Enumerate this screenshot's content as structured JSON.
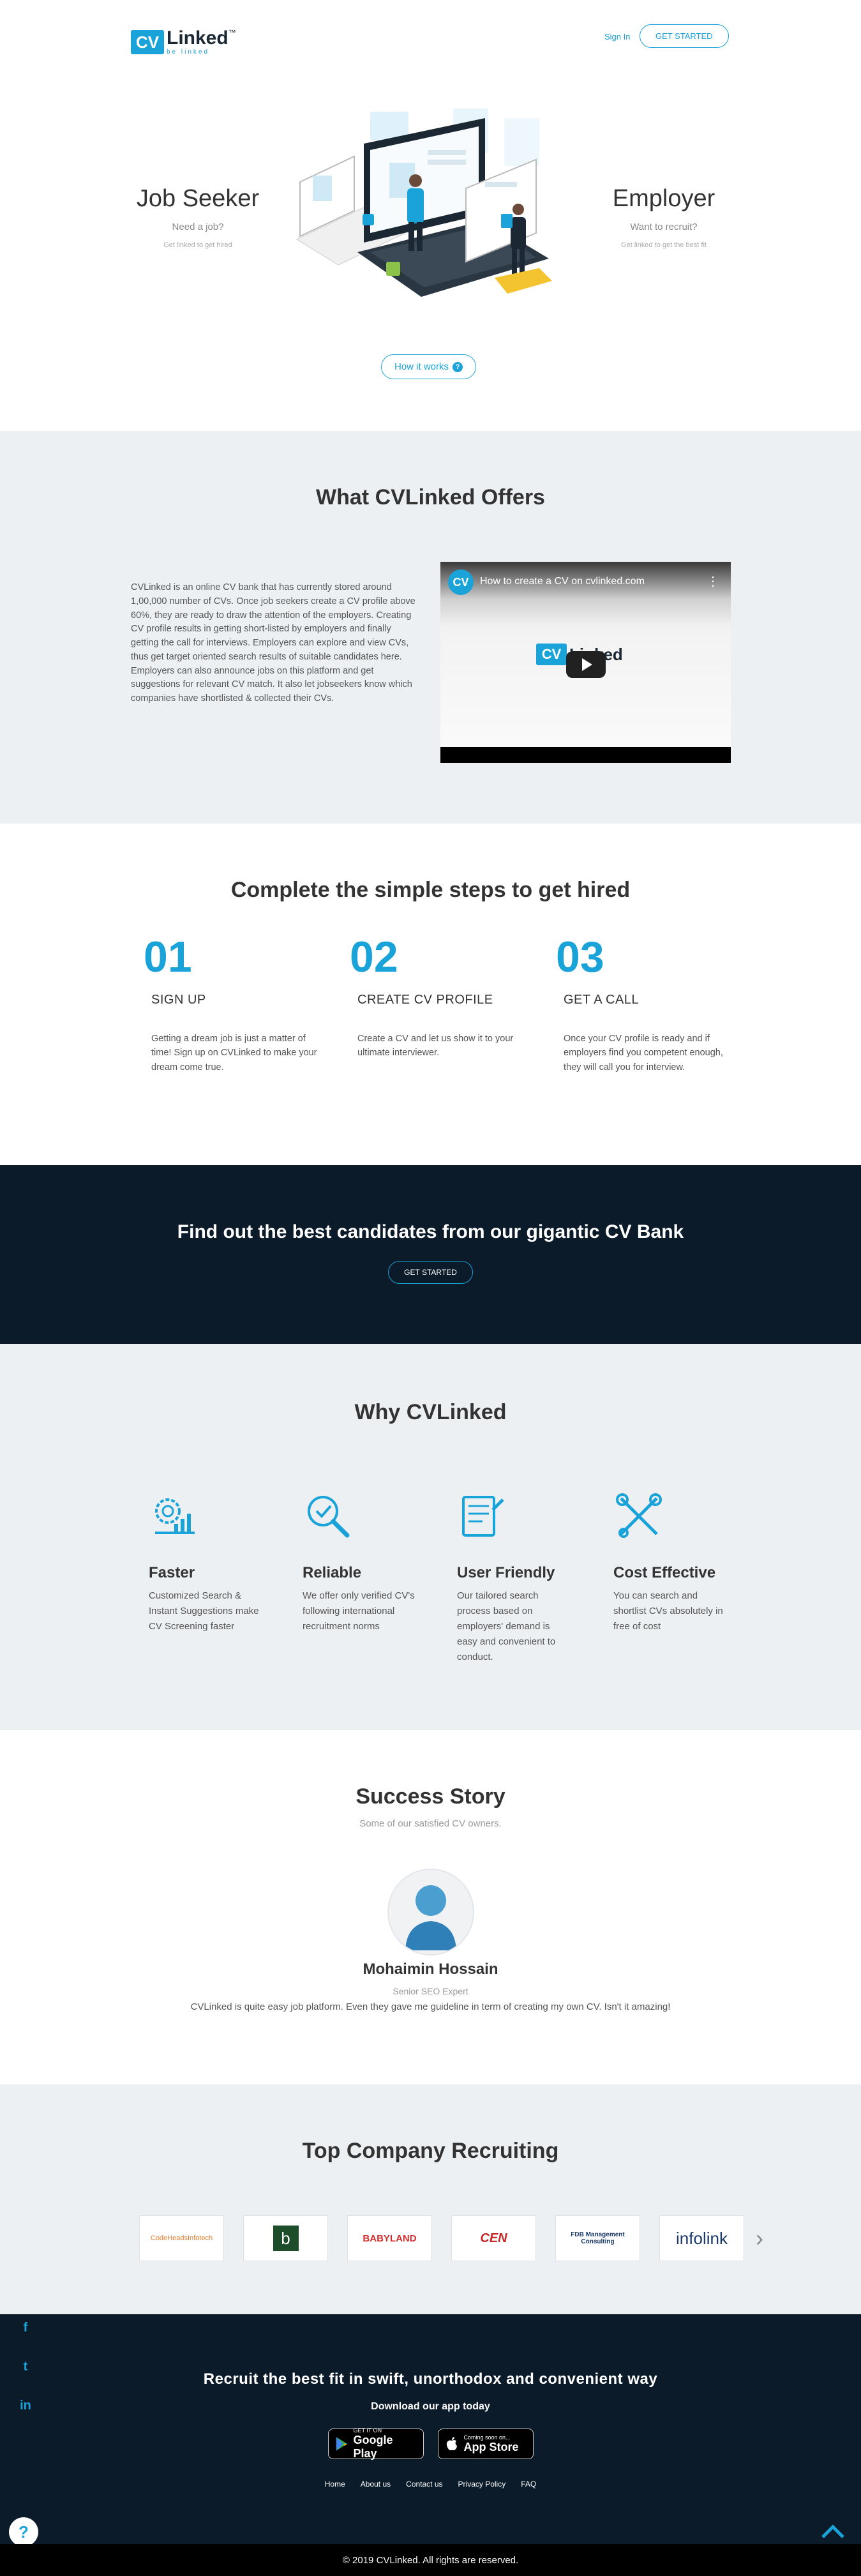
{
  "header": {
    "brand_mark": "CV",
    "brand_word": "Linked",
    "brand_tm": "™",
    "brand_tag": "be linked",
    "signin": "Sign In",
    "get_started": "GET STARTED"
  },
  "hero": {
    "left": {
      "title": "Job Seeker",
      "question": "Need a job?",
      "sub": "Get linked to get hired"
    },
    "right": {
      "title": "Employer",
      "question": "Want to recruit?",
      "sub": "Get linked to get the best fit"
    },
    "how_it_works": "How it works"
  },
  "offers": {
    "title": "What CVLinked Offers",
    "body": "CVLinked is an online CV bank that has currently stored around 1,00,000 number of CVs. Once job seekers create a CV profile above 60%, they are ready to draw the attention of the employers. Creating CV profile results in getting short-listed by employers and finally getting the call for interviews. Employers can explore and view CVs, thus get target oriented search results of suitable candidates here. Employers can also announce jobs on this platform and get suggestions for relevant CV match. It also let jobseekers know which companies have shortlisted & collected their CVs.",
    "video_title": "How to create a CV on cvlinked.com"
  },
  "steps": {
    "title": "Complete the simple steps to get hired",
    "items": [
      {
        "num": "01",
        "name": "SIGN UP",
        "desc": "Getting a dream job is just a matter of time! Sign up on CVLinked to make your dream come true."
      },
      {
        "num": "02",
        "name": "CREATE CV PROFILE",
        "desc": "Create a CV and let us show it to your ultimate interviewer."
      },
      {
        "num": "03",
        "name": "GET A CALL",
        "desc": "Once your CV profile is ready and if employers find you competent enough, they will call you for interview."
      }
    ]
  },
  "cvbank": {
    "title": "Find out the best candidates from our gigantic CV Bank",
    "button": "GET STARTED"
  },
  "why": {
    "title": "Why CVLinked",
    "items": [
      {
        "name": "Faster",
        "desc": "Customized Search & Instant Suggestions make CV Screening faster",
        "icon": "speed-gear-icon"
      },
      {
        "name": "Reliable",
        "desc": "We offer only verified CV's following international recruitment norms",
        "icon": "magnifier-check-icon"
      },
      {
        "name": "User Friendly",
        "desc": "Our tailored search process based on employers' demand is easy and convenient to conduct.",
        "icon": "checklist-icon"
      },
      {
        "name": "Cost Effective",
        "desc": "You can search and shortlist CVs absolutely in free of cost",
        "icon": "tools-icon"
      }
    ]
  },
  "success": {
    "title": "Success Story",
    "subtitle": "Some of our satisfied CV owners.",
    "name": "Mohaimin Hossain",
    "role": "Senior SEO Expert",
    "quote": "CVLinked is quite easy job platform. Even they gave me guideline in term of creating my own CV. Isn't it amazing!"
  },
  "companies": {
    "title": "Top Company Recruiting",
    "logos": [
      "CodeHeadsInfotech",
      "b",
      "BABYLAND",
      "CEN",
      "FDB Management Consulting",
      "infolink"
    ]
  },
  "footer": {
    "tagline": "Recruit the best fit in swift, unorthodox and convenient way",
    "download": "Download our app today",
    "google_small": "GET IT ON",
    "google": "Google Play",
    "apple_small": "Coming soon on...",
    "apple": "App Store",
    "links": [
      "Home",
      "About us",
      "Contact us",
      "Privacy Policy",
      "FAQ"
    ],
    "social": [
      "f",
      "t",
      "in"
    ],
    "copyright": "© 2019 CVLinked. All rights are reserved."
  }
}
